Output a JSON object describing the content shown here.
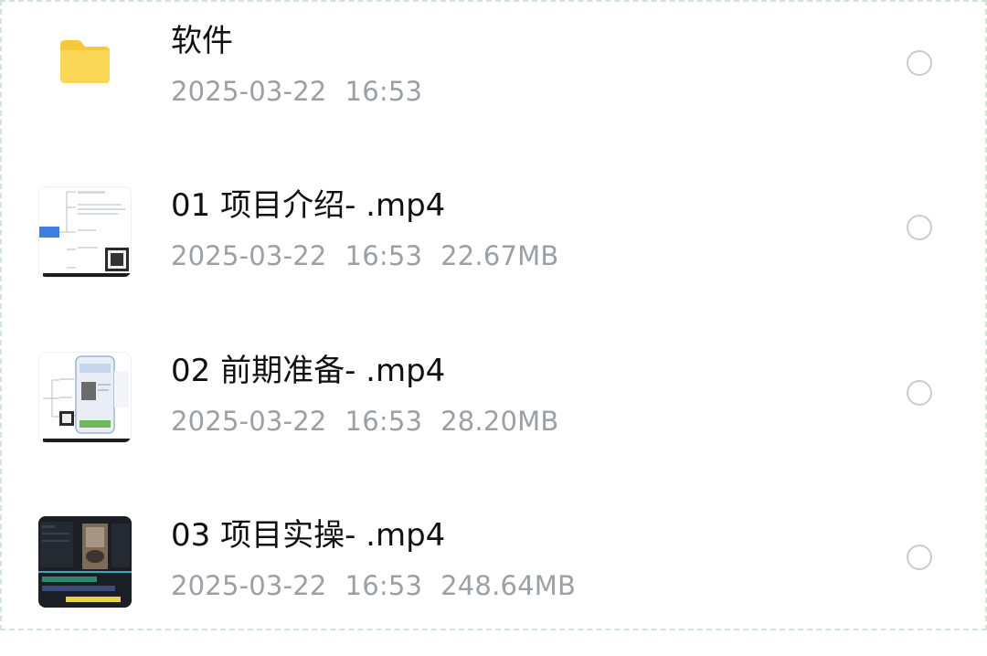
{
  "files": [
    {
      "type": "folder",
      "icon": "folder-icon",
      "name": "软件",
      "date": "2025-03-22",
      "time": "16:53",
      "size": ""
    },
    {
      "type": "video",
      "icon": "video-thumbnail-icon",
      "name": "01 项目介绍- .mp4",
      "date": "2025-03-22",
      "time": "16:53",
      "size": "22.67MB"
    },
    {
      "type": "video",
      "icon": "video-thumbnail-icon",
      "name": "02 前期准备- .mp4",
      "date": "2025-03-22",
      "time": "16:53",
      "size": "28.20MB"
    },
    {
      "type": "video",
      "icon": "video-thumbnail-icon",
      "name": "03 项目实操- .mp4",
      "date": "2025-03-22",
      "time": "16:53",
      "size": "248.64MB"
    }
  ],
  "colors": {
    "folder": "#f8cf46",
    "name_text": "#111111",
    "meta_text": "#9ba0a6",
    "radio_border": "#c9ccd0"
  }
}
